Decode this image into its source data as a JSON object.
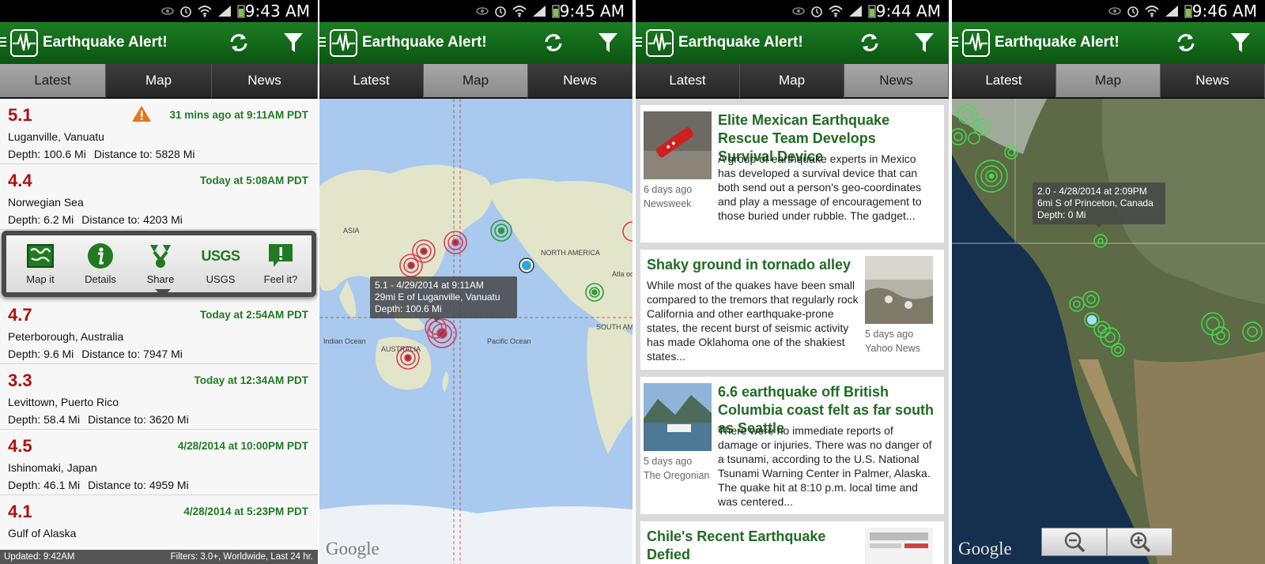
{
  "app": {
    "title": "Earthquake Alert!",
    "tabs": [
      "Latest",
      "Map",
      "News"
    ],
    "accent": "#1d7d24",
    "magnitude_color": "#b01010"
  },
  "screens": [
    {
      "time": "9:43 AM"
    },
    {
      "time": "9:45 AM"
    },
    {
      "time": "9:44 AM"
    },
    {
      "time": "9:46 AM"
    }
  ],
  "latest": {
    "items": [
      {
        "mag": "5.1",
        "when": "31 mins ago at 9:11AM PDT",
        "place": "Luganville, Vanuatu",
        "depth": "Depth: 100.6 Mi",
        "distance": "Distance to: 5828 Mi",
        "alert_icon": "warning-icon"
      },
      {
        "mag": "4.4",
        "when": "Today at 5:08AM PDT",
        "place": "Norwegian Sea",
        "depth": "Depth: 6.2 Mi",
        "distance": "Distance to: 4203 Mi"
      },
      {
        "mag": "4.7",
        "when": "Today at 2:54AM PDT",
        "place": "Peterborough, Australia",
        "depth": "Depth: 9.6 Mi",
        "distance": "Distance to: 7947 Mi"
      },
      {
        "mag": "3.3",
        "when": "Today at 12:34AM PDT",
        "place": "Levittown, Puerto Rico",
        "depth": "Depth: 58.4 Mi",
        "distance": "Distance to: 3620 Mi"
      },
      {
        "mag": "4.5",
        "when": "4/28/2014 at 10:00PM PDT",
        "place": "Ishinomaki, Japan",
        "depth": "Depth: 46.1 Mi",
        "distance": "Distance to: 4959 Mi"
      },
      {
        "mag": "4.1",
        "when": "4/28/2014 at 5:23PM PDT",
        "place": "Gulf of Alaska"
      }
    ],
    "actions": [
      "Map it",
      "Details",
      "Share",
      "USGS",
      "Feel it?"
    ],
    "usgs_logo": "USGS",
    "footer_left": "Updated: 9:42AM",
    "footer_right": "Filters: 3.0+, Worldwide, Last 24 hr."
  },
  "map_world": {
    "tooltip": [
      "5.1 - 4/29/2014 at 9:11AM",
      "29mi E of Luganville, Vanuatu",
      "Depth: 100.6 Mi"
    ],
    "labels": {
      "asia": "ASIA",
      "north_america": "NORTH AMERICA",
      "south_america": "SOUTH AMERICA",
      "australia": "AUSTRALIA",
      "indian_ocean": "Indian Ocean",
      "pacific_ocean": "Pacific Ocean",
      "atlantic": "Atla oc"
    },
    "attribution": "Google"
  },
  "news": {
    "articles": [
      {
        "title": "Elite Mexican Earthquake Rescue Team Develops Survival Device",
        "body": "A group of earthquake experts in Mexico has developed a survival device that can both send out a person's geo-coordinates and play a message of encouragement to those buried under rubble. The gadget...",
        "age": "6 days ago",
        "source": "Newsweek"
      },
      {
        "title": "Shaky ground in tornado alley",
        "body": "While most of the quakes have been small compared to the tremors that regularly rock California and other earthquake-prone states, the recent burst of seismic activity has made Oklahoma one of the shakiest states...",
        "age": "5 days ago",
        "source": "Yahoo News"
      },
      {
        "title": "6.6 earthquake off British Columbia coast felt as far south as Seattle",
        "body": "There were no immediate reports of damage or injuries. There was no danger of a tsunami, according to the U.S. National Tsunami Warning Center in Palmer, Alaska. The quake hit at 8:10 p.m. local time and was centered...",
        "age": "5 days ago",
        "source": "The Oregonian"
      },
      {
        "title": "Chile's Recent Earthquake Defied"
      }
    ]
  },
  "map_na": {
    "tooltip": [
      "2.0 - 4/28/2014 at 2:09PM",
      "6mi S of Princeton, Canada",
      "Depth: 0 Mi"
    ],
    "attribution": "Google"
  }
}
